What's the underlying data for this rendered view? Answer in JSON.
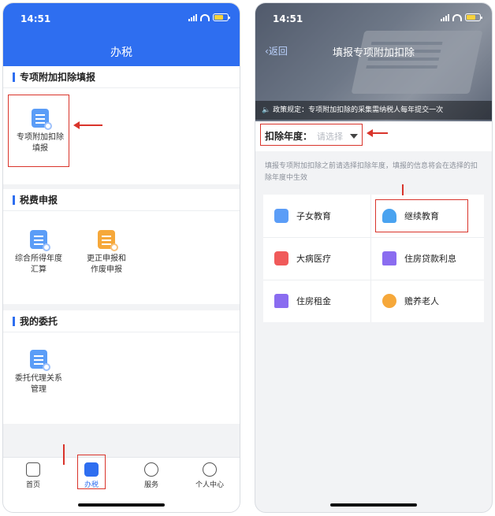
{
  "left_screen": {
    "status_time": "14:51",
    "title": "办税",
    "sections": [
      {
        "heading": "专项附加扣除填报",
        "items": [
          {
            "label_line1": "专项附加扣除",
            "label_line2": "填报"
          }
        ]
      },
      {
        "heading": "税费申报",
        "items": [
          {
            "label_line1": "综合所得年度",
            "label_line2": "汇算"
          },
          {
            "label_line1": "更正申报和",
            "label_line2": "作废申报"
          }
        ]
      },
      {
        "heading": "我的委托",
        "items": [
          {
            "label_line1": "委托代理关系",
            "label_line2": "管理"
          }
        ]
      }
    ],
    "tabs": [
      {
        "label": "首页",
        "icon": "home-icon"
      },
      {
        "label": "办税",
        "icon": "edit-document-icon",
        "active": true
      },
      {
        "label": "服务",
        "icon": "heart-hand-icon"
      },
      {
        "label": "个人中心",
        "icon": "user-icon"
      }
    ]
  },
  "right_screen": {
    "status_time": "14:51",
    "back_label": "返回",
    "title": "填报专项附加扣除",
    "notice": "政策规定：专项附加扣除的采集需纳税人每年提交一次",
    "year_label": "扣除年度：",
    "year_placeholder": "请选择",
    "description": "填报专项附加扣除之前请选择扣除年度，填报的信息将会在选择的扣除年度中生效",
    "categories": [
      {
        "label": "子女教育",
        "icon": "books-icon",
        "color": "#5b9df7"
      },
      {
        "label": "继续教育",
        "icon": "graduation-cap-icon",
        "color": "#4aa3f0"
      },
      {
        "label": "大病医疗",
        "icon": "medical-kit-icon",
        "color": "#f05a5a"
      },
      {
        "label": "住房贷款利息",
        "icon": "house-loan-icon",
        "color": "#8a6cf0"
      },
      {
        "label": "住房租金",
        "icon": "house-rent-icon",
        "color": "#8a6cf0"
      },
      {
        "label": "赡养老人",
        "icon": "elderly-icon",
        "color": "#f6a83a"
      }
    ]
  }
}
